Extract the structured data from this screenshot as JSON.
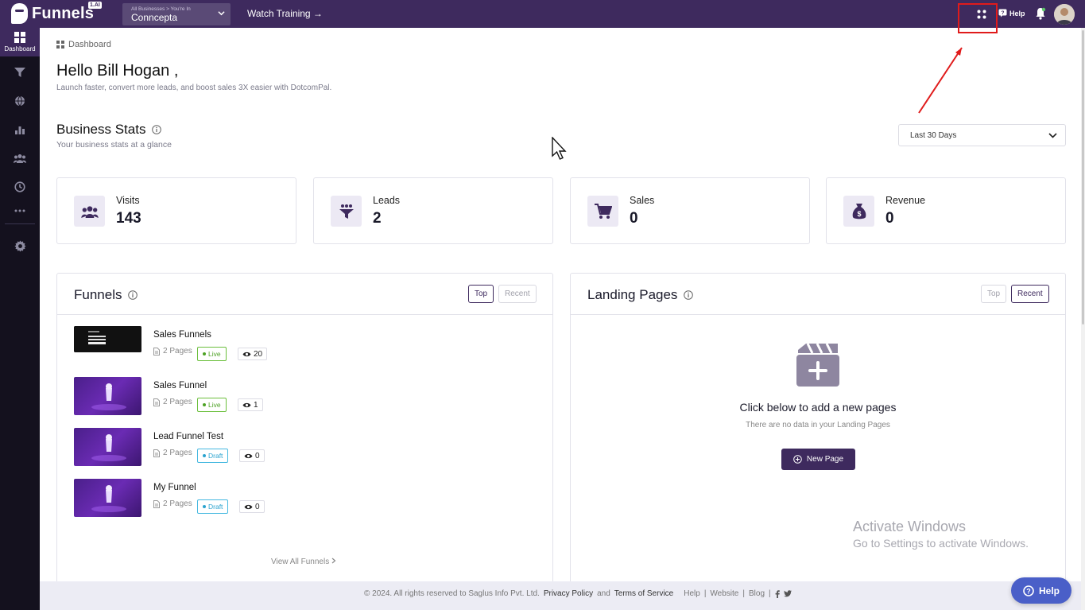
{
  "topbar": {
    "brand": "Funnels",
    "brand_badge": "1.AI",
    "business_caption": "All Businesses > You're In",
    "business_name": "Conncepta",
    "watch_training": "Watch Training →",
    "help_label": "Help"
  },
  "sidebar": {
    "items": [
      {
        "icon": "grid-icon",
        "label": "Dashboard",
        "active": true
      },
      {
        "icon": "filter-icon"
      },
      {
        "icon": "globe-icon"
      },
      {
        "icon": "chart-icon"
      },
      {
        "icon": "users-icon"
      },
      {
        "icon": "clock-icon"
      },
      {
        "icon": "more-icon"
      },
      {
        "icon": "gear-icon"
      }
    ]
  },
  "breadcrumb": "Dashboard",
  "greeting": {
    "title": "Hello Bill Hogan ,",
    "subtitle": "Launch faster, convert more leads, and boost sales 3X easier with DotcomPal."
  },
  "business_stats": {
    "title": "Business Stats",
    "subtitle": "Your business stats at a glance",
    "range": "Last 30 Days",
    "cards": [
      {
        "label": "Visits",
        "value": "143",
        "icon": "users-icon"
      },
      {
        "label": "Leads",
        "value": "2",
        "icon": "funnel-icon"
      },
      {
        "label": "Sales",
        "value": "0",
        "icon": "cart-icon"
      },
      {
        "label": "Revenue",
        "value": "0",
        "icon": "money-bag-icon"
      }
    ]
  },
  "funnels": {
    "title": "Funnels",
    "tab_top": "Top",
    "tab_recent": "Recent",
    "rows": [
      {
        "name": "Sales Funnels",
        "pages": "2 Pages",
        "status": "Live",
        "views": "20"
      },
      {
        "name": "Sales Funnel",
        "pages": "2 Pages",
        "status": "Live",
        "views": "1"
      },
      {
        "name": "Lead Funnel Test",
        "pages": "2 Pages",
        "status": "Draft",
        "views": "0"
      },
      {
        "name": "My Funnel",
        "pages": "2 Pages",
        "status": "Draft",
        "views": "0"
      }
    ],
    "view_all": "View All Funnels"
  },
  "landing_pages": {
    "title": "Landing Pages",
    "tab_top": "Top",
    "tab_recent": "Recent",
    "empty_title": "Click below to add a new pages",
    "empty_subtitle": "There are no data in your Landing Pages",
    "new_page": "New Page"
  },
  "watermark": {
    "line1": "Activate Windows",
    "line2": "Go to Settings to activate Windows."
  },
  "footer": {
    "copyright": "©  2024. All rights reserved to Saglus Info Pvt. Ltd.",
    "privacy": "Privacy Policy",
    "and": "and",
    "terms": "Terms of Service",
    "help": "Help",
    "website": "Website",
    "blog": "Blog",
    "sep": "|"
  },
  "help_fab": "Help",
  "colors": {
    "brand": "#3e2a5e",
    "sidebar": "#14111e",
    "live": "#4da224",
    "draft": "#2aa3cf",
    "help_fab": "#4a5fc8"
  }
}
